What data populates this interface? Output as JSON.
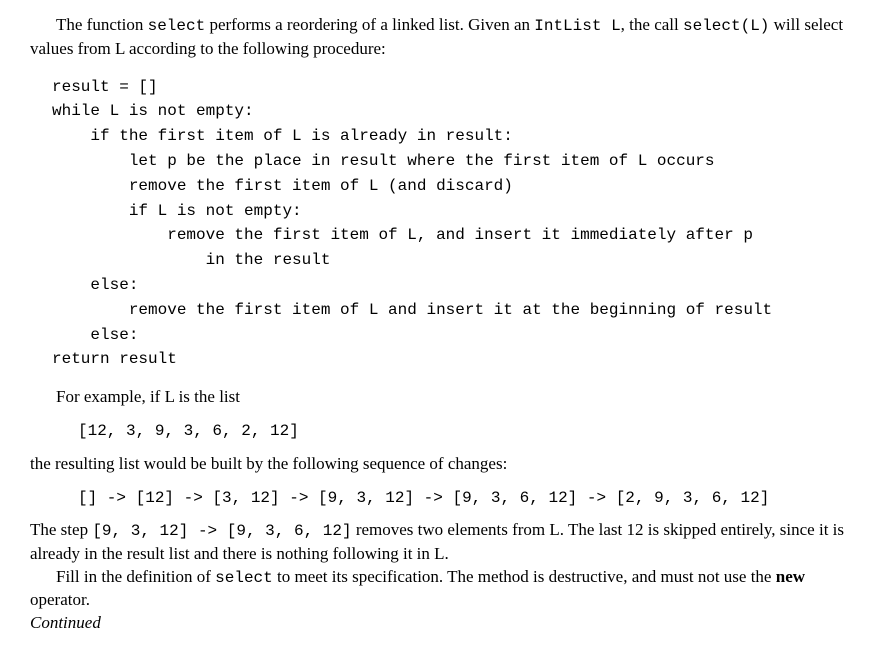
{
  "intro": {
    "part1": "The function ",
    "code1": "select",
    "part2": " performs a reordering of a linked list. Given an ",
    "code2": "IntList L",
    "part3": ", the call ",
    "code3": "select(L)",
    "part4": " will select values from L according to the following procedure:"
  },
  "pseudocode": "result = []\nwhile L is not empty:\n    if the first item of L is already in result:\n        let p be the place in result where the first item of L occurs\n        remove the first item of L (and discard)\n        if L is not empty:\n            remove the first item of L, and insert it immediately after p\n                in the result\n    else:\n        remove the first item of L and insert it at the beginning of result\n    else:\nreturn result",
  "example_intro": "For example, if L is the list",
  "example_list": "[12, 3, 9, 3, 6, 2, 12]",
  "example_mid": "the resulting list would be built by the following sequence of changes:",
  "example_seq": "[] -> [12] -> [3, 12] -> [9, 3, 12] -> [9, 3, 6, 12] -> [2, 9, 3, 6, 12]",
  "explain": {
    "part1": "The step ",
    "code1": "[9, 3, 12] -> [9, 3, 6, 12]",
    "part2": " removes two elements from L. The last 12 is skipped entirely, since it is already in the result list and there is nothing following it in L."
  },
  "fillin": {
    "part1": "Fill in the definition of ",
    "code1": "select",
    "part2": " to meet its specification. The method is destructive, and must not use the ",
    "bold1": "new",
    "part3": " operator."
  },
  "continued": "Continued"
}
